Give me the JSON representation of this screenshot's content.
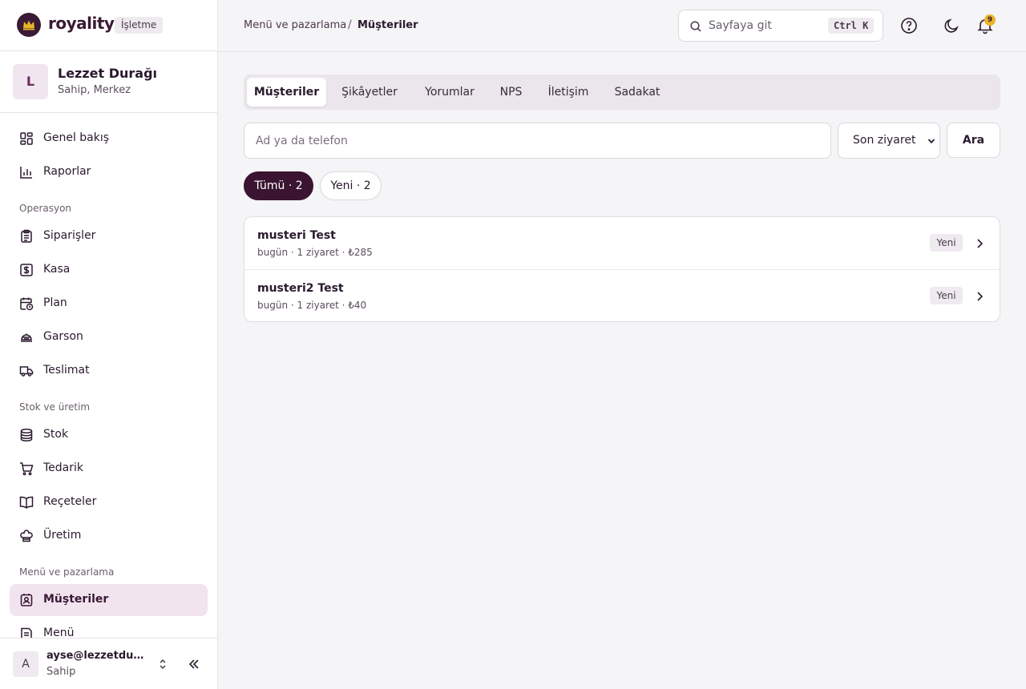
{
  "brand": {
    "name": "royality",
    "badge": "İşletme"
  },
  "business": {
    "initial": "L",
    "name": "Lezzet Durağı",
    "role": "Sahip, Merkez"
  },
  "nav": {
    "general": {
      "label": "Genel bakış",
      "icon": "layout-grid-icon"
    },
    "reports": {
      "label": "Raporlar",
      "icon": "bar-chart-icon"
    },
    "section_operations": "Operasyon",
    "orders": {
      "label": "Siparişler",
      "icon": "clipboard-list-icon"
    },
    "cashier": {
      "label": "Kasa",
      "icon": "cash-register-icon"
    },
    "plan": {
      "label": "Plan",
      "icon": "calendar-clock-icon"
    },
    "waiter": {
      "label": "Garson",
      "icon": "cloche-icon"
    },
    "delivery": {
      "label": "Teslimat",
      "icon": "truck-icon"
    },
    "section_stock": "Stok ve üretim",
    "stock": {
      "label": "Stok",
      "icon": "database-icon"
    },
    "supply": {
      "label": "Tedarik",
      "icon": "shopping-cart-icon"
    },
    "recipes": {
      "label": "Reçeteler",
      "icon": "book-open-icon"
    },
    "production": {
      "label": "Üretim",
      "icon": "chef-hat-icon"
    },
    "section_marketing": "Menü ve pazarlama",
    "customers": {
      "label": "Müşteriler",
      "icon": "contact-icon",
      "active": true
    },
    "menu": {
      "label": "Menü",
      "icon": "menu-book-icon"
    }
  },
  "user": {
    "initial": "A",
    "email": "ayse@lezzetduragi.com",
    "role": "Sahip"
  },
  "topbar": {
    "breadcrumb_parent": "Menü ve pazarlama",
    "breadcrumb_sep": "/",
    "breadcrumb_current": "Müşteriler",
    "goto_placeholder": "Sayfaya git",
    "shortcut": "Ctrl K",
    "notifications_count": "9"
  },
  "tabs": [
    {
      "label": "Müşteriler",
      "active": true
    },
    {
      "label": "Şikâyetler"
    },
    {
      "label": "Yorumlar"
    },
    {
      "label": "NPS"
    },
    {
      "label": "İletişim"
    },
    {
      "label": "Sadakat"
    }
  ],
  "search": {
    "placeholder": "Ad ya da telefon",
    "value": ""
  },
  "sort": {
    "selected": "Son ziyaret"
  },
  "search_button": "Ara",
  "filters": [
    {
      "label": "Tümü · 2",
      "active": true
    },
    {
      "label": "Yeni · 2",
      "active": false
    }
  ],
  "customers": [
    {
      "name": "musteri Test",
      "meta": "bugün · 1 ziyaret · ₺285",
      "badge": "Yeni"
    },
    {
      "name": "musteri2 Test",
      "meta": "bugün · 1 ziyaret · ₺40",
      "badge": "Yeni"
    }
  ],
  "colors": {
    "brand_dark": "#3a1430",
    "active_nav_bg": "#f1e4ef",
    "notification_badge": "#e8b52a"
  }
}
